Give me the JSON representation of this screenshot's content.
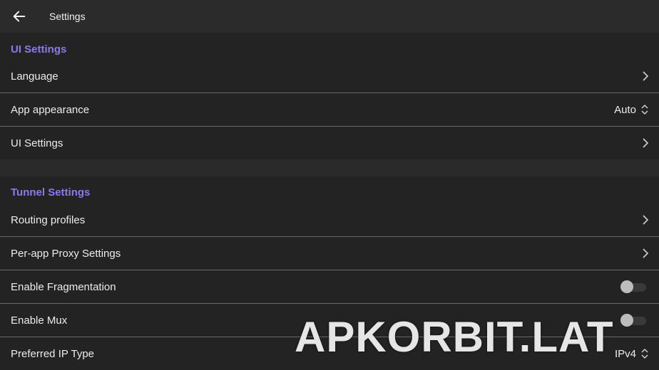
{
  "app_bar": {
    "title": "Settings"
  },
  "ui_section": {
    "header": "UI Settings",
    "items": [
      {
        "label": "Language"
      },
      {
        "label": "App appearance",
        "value": "Auto"
      },
      {
        "label": "UI Settings"
      }
    ]
  },
  "tunnel_section": {
    "header": "Tunnel Settings",
    "items": [
      {
        "label": "Routing profiles"
      },
      {
        "label": "Per-app Proxy Settings"
      },
      {
        "label": "Enable Fragmentation",
        "enabled": false
      },
      {
        "label": "Enable Mux",
        "enabled": false
      },
      {
        "label": "Preferred IP Type",
        "value": "IPv4"
      }
    ]
  },
  "watermark": "APKORBIT.LAT",
  "colors": {
    "accent": "#8b79ee",
    "background": "#202020",
    "app_bar": "#2b2b2b"
  }
}
